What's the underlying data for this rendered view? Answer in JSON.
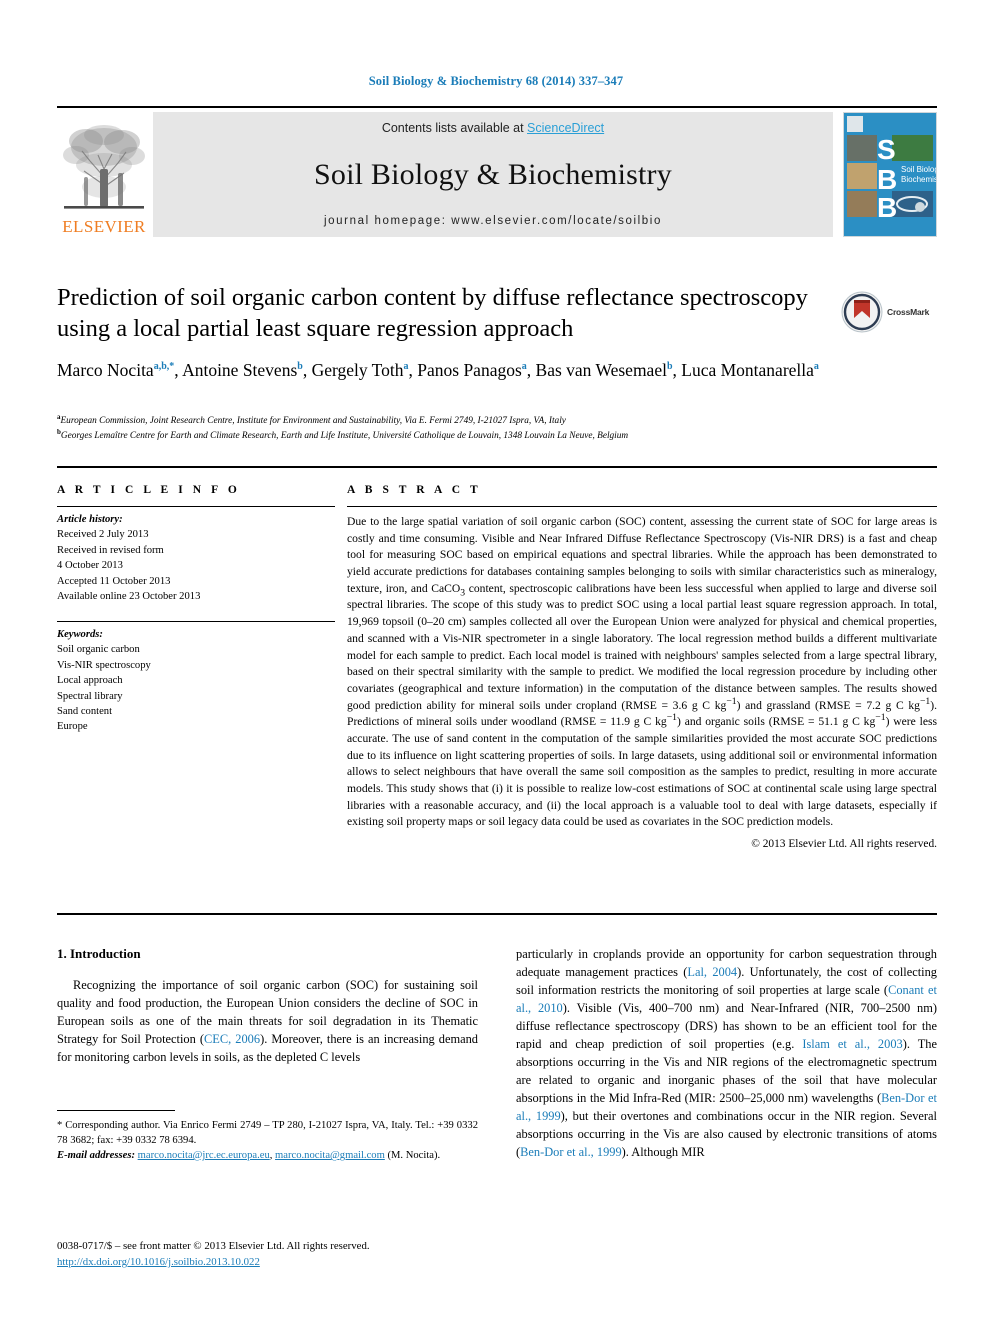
{
  "running_head": "Soil Biology & Biochemistry 68 (2014) 337–347",
  "masthead": {
    "contents_prefix": "Contents lists available at ",
    "sciencedirect": "ScienceDirect",
    "journal_title": "Soil Biology & Biochemistry",
    "homepage": "journal homepage: www.elsevier.com/locate/soilbio",
    "publisher_word": "ELSEVIER",
    "cover_letters": [
      "S",
      "B",
      "B"
    ],
    "cover_caption_line1": "Soil Biology &",
    "cover_caption_line2": "Biochemistry"
  },
  "article": {
    "title": "Prediction of soil organic carbon content by diffuse reflectance spectroscopy using a local partial least square regression approach",
    "crossmark_label": "CrossMark",
    "authors": [
      {
        "name": "Marco Nocita",
        "marks": "a,b,*",
        "sep": ", "
      },
      {
        "name": "Antoine Stevens",
        "marks": "b",
        "sep": ", "
      },
      {
        "name": "Gergely Toth",
        "marks": "a",
        "sep": ", "
      },
      {
        "name": "Panos Panagos",
        "marks": "a",
        "sep": ", "
      },
      {
        "name": "Bas van Wesemael",
        "marks": "b",
        "sep": ", "
      },
      {
        "name": "Luca Montanarella",
        "marks": "a",
        "sep": ""
      }
    ],
    "affiliations": [
      {
        "mark": "a",
        "text": "European Commission, Joint Research Centre, Institute for Environment and Sustainability, Via E. Fermi 2749, I-21027 Ispra, VA, Italy"
      },
      {
        "mark": "b",
        "text": "Georges Lemaître Centre for Earth and Climate Research, Earth and Life Institute, Université Catholique de Louvain, 1348 Louvain La Neuve, Belgium"
      }
    ]
  },
  "article_info": {
    "heading": "A R T I C L E  I N F O",
    "history_label": "Article history:",
    "history": [
      "Received 2 July 2013",
      "Received in revised form",
      "4 October 2013",
      "Accepted 11 October 2013",
      "Available online 23 October 2013"
    ],
    "keywords_label": "Keywords:",
    "keywords": [
      "Soil organic carbon",
      "Vis-NIR spectroscopy",
      "Local approach",
      "Spectral library",
      "Sand content",
      "Europe"
    ]
  },
  "abstract": {
    "heading": "A B S T R A C T",
    "text": "Due to the large spatial variation of soil organic carbon (SOC) content, assessing the current state of SOC for large areas is costly and time consuming. Visible and Near Infrared Diffuse Reflectance Spectroscopy (Vis-NIR DRS) is a fast and cheap tool for measuring SOC based on empirical equations and spectral libraries. While the approach has been demonstrated to yield accurate predictions for databases containing samples belonging to soils with similar characteristics such as mineralogy, texture, iron, and CaCO3 content, spectroscopic calibrations have been less successful when applied to large and diverse soil spectral libraries. The scope of this study was to predict SOC using a local partial least square regression approach. In total, 19,969 topsoil (0–20 cm) samples collected all over the European Union were analyzed for physical and chemical properties, and scanned with a Vis-NIR spectrometer in a single laboratory. The local regression method builds a different multivariate model for each sample to predict. Each local model is trained with neighbours' samples selected from a large spectral library, based on their spectral similarity with the sample to predict. We modified the local regression procedure by including other covariates (geographical and texture information) in the computation of the distance between samples. The results showed good prediction ability for mineral soils under cropland (RMSE = 3.6 g C kg−1) and grassland (RMSE = 7.2 g C kg−1). Predictions of mineral soils under woodland (RMSE = 11.9 g C kg−1) and organic soils (RMSE = 51.1 g C kg−1) were less accurate. The use of sand content in the computation of the sample similarities provided the most accurate SOC predictions due to its influence on light scattering properties of soils. In large datasets, using additional soil or environmental information allows to select neighbours that have overall the same soil composition as the samples to predict, resulting in more accurate models. This study shows that (i) it is possible to realize low-cost estimations of SOC at continental scale using large spectral libraries with a reasonable accuracy, and (ii) the local approach is a valuable tool to deal with large datasets, especially if existing soil property maps or soil legacy data could be used as covariates in the SOC prediction models.",
    "copyright": "© 2013 Elsevier Ltd. All rights reserved."
  },
  "introduction": {
    "heading": "1. Introduction",
    "left_paragraph_part1": "Recognizing the importance of soil organic carbon (SOC) for sustaining soil quality and food production, the European Union considers the decline of SOC in European soils as one of the main threats for soil degradation in its Thematic Strategy for Soil Protection (",
    "left_cite1": "CEC, 2006",
    "left_paragraph_part2": "). Moreover, there is an increasing demand for monitoring carbon levels in soils, as the depleted C levels",
    "right_part1": "particularly in croplands provide an opportunity for carbon sequestration through adequate management practices (",
    "right_cite1": "Lal, 2004",
    "right_part2": "). Unfortunately, the cost of collecting soil information restricts the monitoring of soil properties at large scale (",
    "right_cite2": "Conant et al., 2010",
    "right_part3": "). Visible (Vis, 400–700 nm) and Near-Infrared (NIR, 700–2500 nm) diffuse reflectance spectroscopy (DRS) has shown to be an efficient tool for the rapid and cheap prediction of soil properties (e.g. ",
    "right_cite3": "Islam et al., 2003",
    "right_part4": "). The absorptions occurring in the Vis and NIR regions of the electromagnetic spectrum are related to organic and inorganic phases of the soil that have molecular absorptions in the Mid Infra-Red (MIR: 2500–25,000 nm) wavelengths (",
    "right_cite4": "Ben-Dor et al., 1999",
    "right_part5": "), but their overtones and combinations occur in the NIR region. Several absorptions occurring in the Vis are also caused by electronic transitions of atoms (",
    "right_cite5": "Ben-Dor et al., 1999",
    "right_part6": "). Although MIR"
  },
  "footnotes": {
    "corresponding": "* Corresponding author. Via Enrico Fermi 2749 – TP 280, I-21027 Ispra, VA, Italy. Tel.: +39 0332 78 3682; fax: +39 0332 78 6394.",
    "email_label": "E-mail addresses:",
    "email1": "marco.nocita@jrc.ec.europa.eu",
    "email_sep": ", ",
    "email2": "marco.nocita@gmail.com",
    "email_tail": " (M. Nocita)."
  },
  "imprint": {
    "line1": "0038-0717/$ – see front matter © 2013 Elsevier Ltd. All rights reserved.",
    "doi": "http://dx.doi.org/10.1016/j.soilbio.2013.10.022"
  },
  "colors": {
    "link": "#1a7cb8",
    "sciencedirect": "#2a9fd6",
    "elsevier_orange": "#ef7d22",
    "masthead_bg": "#e6e6e6",
    "cover_blue": "#2b8fc4"
  }
}
